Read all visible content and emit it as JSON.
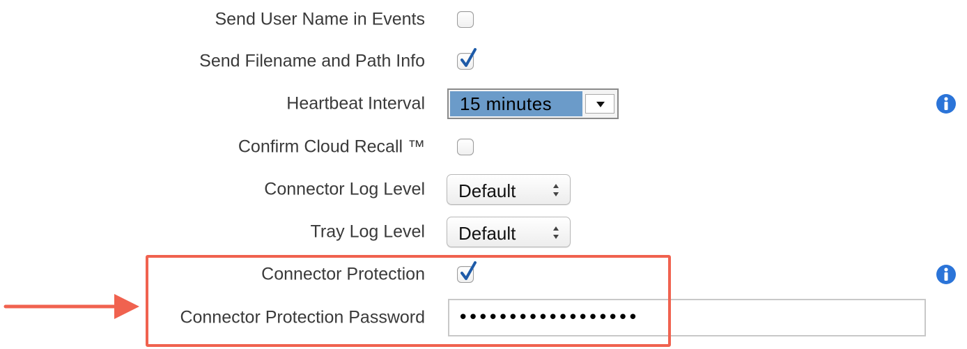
{
  "settings": {
    "send_user_name": {
      "label": "Send User Name in Events",
      "checked": false
    },
    "send_filename": {
      "label": "Send Filename and Path Info",
      "checked": true
    },
    "heartbeat": {
      "label": "Heartbeat Interval",
      "value": "15 minutes"
    },
    "confirm_cloud_recall": {
      "label": "Confirm Cloud Recall ™",
      "checked": false
    },
    "connector_log_level": {
      "label": "Connector Log Level",
      "value": "Default"
    },
    "tray_log_level": {
      "label": "Tray Log Level",
      "value": "Default"
    },
    "connector_protection": {
      "label": "Connector Protection",
      "checked": true
    },
    "connector_protection_password": {
      "label": "Connector Protection Password",
      "value": "••••••••••••••••••"
    }
  },
  "icons": {
    "info": "info-icon",
    "check": "checkmark-icon",
    "dropdown": "chevron-down-icon",
    "stepper": "up-down-arrows-icon",
    "arrow": "arrow-right-icon"
  },
  "colors": {
    "highlight": "#f0624f",
    "select_selected": "#6b9bc9",
    "checkmark": "#1e5ba8",
    "info": "#2b74d8"
  }
}
